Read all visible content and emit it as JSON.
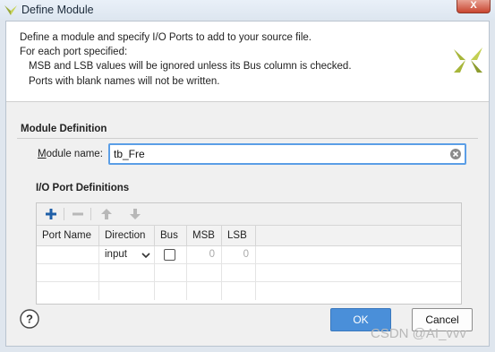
{
  "window": {
    "title": "Define Module",
    "close_label": "X",
    "icons": {
      "app": "vivado-logo-icon",
      "close": "close-icon"
    }
  },
  "header": {
    "lines": [
      "Define a module and specify I/O Ports to add to your source file.",
      "For each port specified:",
      "MSB and LSB values will be ignored unless its Bus column is checked.",
      "Ports with blank names will not be written."
    ],
    "logo_icon": "xilinx-logo-icon"
  },
  "module_definition": {
    "title": "Module Definition",
    "name_label_mnemonic": "M",
    "name_label_rest": "odule name:",
    "name_value": "tb_Fre",
    "clear_icon": "clear-icon"
  },
  "io_ports": {
    "title": "I/O Port Definitions",
    "toolbar": [
      {
        "name": "add",
        "icon": "plus-icon",
        "enabled": true
      },
      {
        "name": "remove",
        "icon": "minus-icon",
        "enabled": false
      },
      {
        "name": "move-up",
        "icon": "arrow-up-icon",
        "enabled": false
      },
      {
        "name": "move-down",
        "icon": "arrow-down-icon",
        "enabled": false
      }
    ],
    "columns": [
      "Port Name",
      "Direction",
      "Bus",
      "MSB",
      "LSB"
    ],
    "rows": [
      {
        "port_name": "",
        "direction": "input",
        "bus": false,
        "msb": "0",
        "lsb": "0"
      }
    ]
  },
  "footer": {
    "help_label": "?",
    "ok_label": "OK",
    "cancel_label": "Cancel"
  },
  "watermark": "CSDN @AI_vvv",
  "colors": {
    "accent": "#4a8fd9",
    "focus_border": "#5b9ee6",
    "logo": "#a7b63a"
  }
}
